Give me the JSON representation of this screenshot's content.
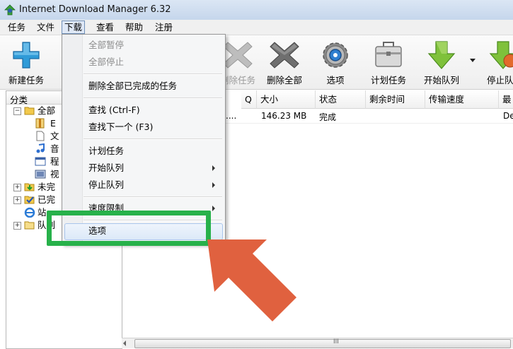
{
  "window": {
    "title": "Internet Download Manager 6.32"
  },
  "menubar": {
    "items": [
      "任务",
      "文件",
      "下载",
      "查看",
      "帮助",
      "注册"
    ]
  },
  "toolbar": {
    "new_task": "新建任务",
    "delete_task": "删除任务",
    "delete_all": "删除全部",
    "options": "选项",
    "scheduler": "计划任务",
    "start_queue": "开始队列",
    "stop_queue": "停止队列"
  },
  "tree": {
    "header": "分类",
    "all": "全部",
    "sub_labels": [
      "E",
      "文",
      "音",
      "程",
      "视"
    ],
    "unfinished": "未完",
    "finished": "已完",
    "site": "站",
    "queue": "队列"
  },
  "list": {
    "columns": [
      "Q",
      "大小",
      "状态",
      "剩余时间",
      "传输速度",
      "最"
    ],
    "rows": [
      {
        "name_fragment": "....",
        "size": "146.23 MB",
        "status": "完成",
        "last": "De"
      }
    ]
  },
  "dropdown": {
    "items": {
      "pause_all": "全部暂停",
      "stop_all": "全部停止",
      "delete_completed": "删除全部已完成的任务",
      "find": "查找 (Ctrl-F)",
      "find_next": "查找下一个 (F3)",
      "scheduler": "计划任务",
      "start_queue": "开始队列",
      "stop_queue": "停止队列",
      "speed_limit": "速度限制",
      "options": "选项"
    }
  },
  "scrollbar": {
    "thumb_grip": "III"
  },
  "colors": {
    "highlight_box": "#27b14a",
    "arrow": "#e0613f"
  }
}
